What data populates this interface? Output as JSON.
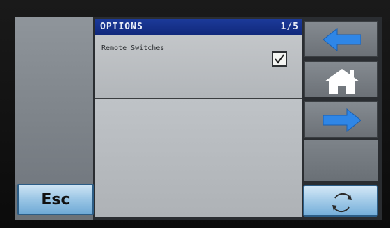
{
  "header": {
    "title": "OPTIONS",
    "page": "1/5"
  },
  "options": [
    {
      "label": "Remote Switches",
      "checked": true
    }
  ],
  "buttons": {
    "esc_label": "Esc",
    "back_icon": "arrow-left-icon",
    "home_icon": "home-icon",
    "forward_icon": "arrow-right-icon",
    "refresh_icon": "refresh-icon"
  },
  "colors": {
    "header_bg": "#10287a",
    "arrow_blue": "#2f86e6",
    "button_blue": "#9ec8e6"
  }
}
